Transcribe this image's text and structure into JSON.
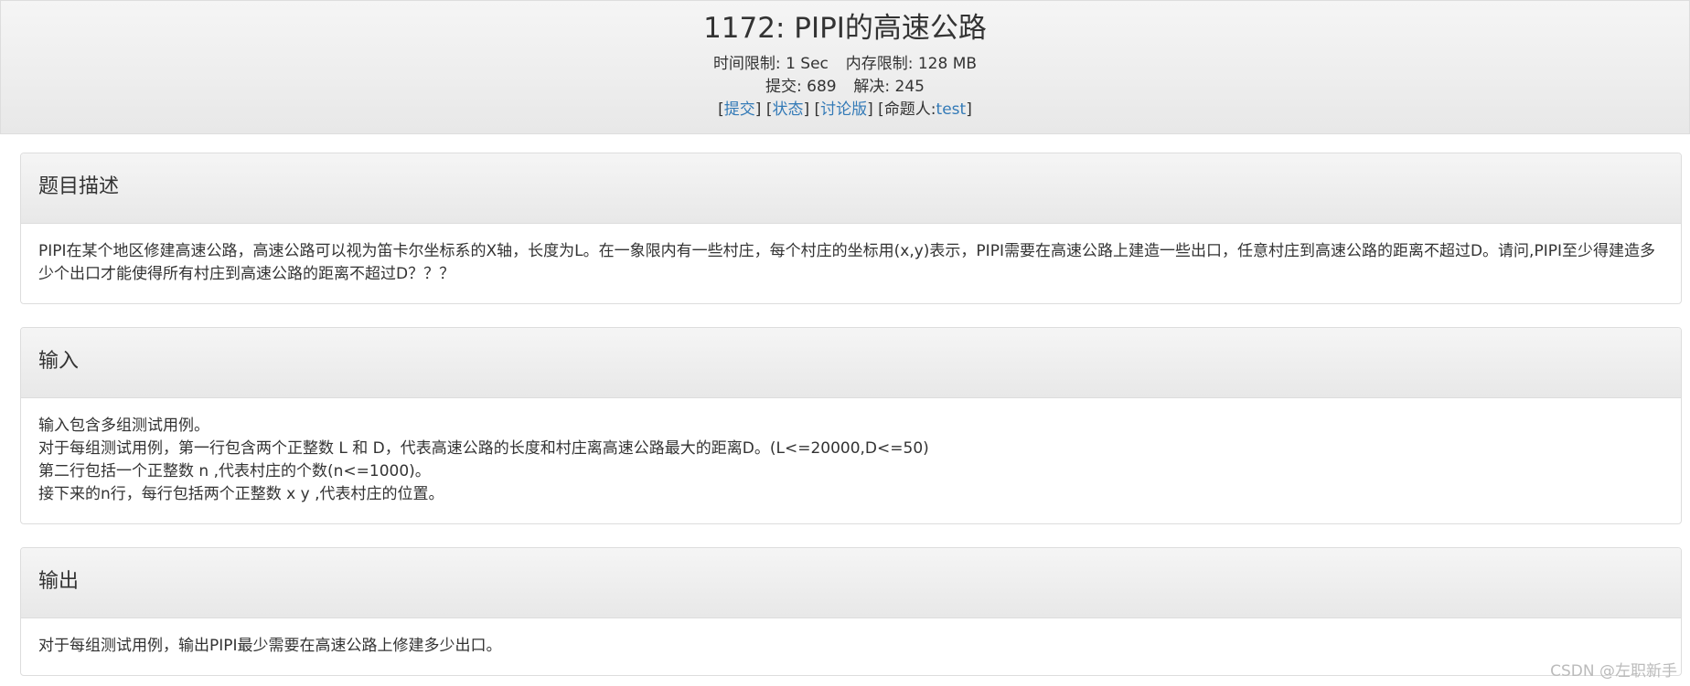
{
  "problem": {
    "title": "1172: PIPI的高速公路",
    "time_limit_label": "时间限制:",
    "time_limit_value": "1 Sec",
    "memory_limit_label": "内存限制:",
    "memory_limit_value": "128 MB",
    "submit_count_label": "提交:",
    "submit_count_value": "689",
    "solved_count_label": "解决:",
    "solved_count_value": "245"
  },
  "links": {
    "submit": "提交",
    "status": "状态",
    "discuss": "讨论版",
    "author_label": "命题人:",
    "author": "test"
  },
  "sections": {
    "description": {
      "heading": "题目描述",
      "text": "PIPI在某个地区修建高速公路，高速公路可以视为笛卡尔坐标系的X轴，长度为L。在一象限内有一些村庄，每个村庄的坐标用(x,y)表示，PIPI需要在高速公路上建造一些出口，任意村庄到高速公路的距离不超过D。请问,PIPI至少得建造多少个出口才能使得所有村庄到高速公路的距离不超过D？？？"
    },
    "input": {
      "heading": "输入",
      "lines": [
        "输入包含多组测试用例。",
        "对于每组测试用例，第一行包含两个正整数 L 和 D，代表高速公路的长度和村庄离高速公路最大的距离D。(L<=20000,D<=50)",
        "第二行包括一个正整数 n ,代表村庄的个数(n<=1000)。",
        "接下来的n行，每行包括两个正整数 x y ,代表村庄的位置。"
      ]
    },
    "output": {
      "heading": "输出",
      "text": "对于每组测试用例，输出PIPI最少需要在高速公路上修建多少出口。"
    }
  },
  "watermark": "CSDN @左职新手",
  "colors": {
    "link": "#337ab7",
    "panel_border": "#dddddd",
    "heading_bg_top": "#f5f5f5",
    "heading_bg_bottom": "#e8e8e8",
    "text": "#333333"
  }
}
